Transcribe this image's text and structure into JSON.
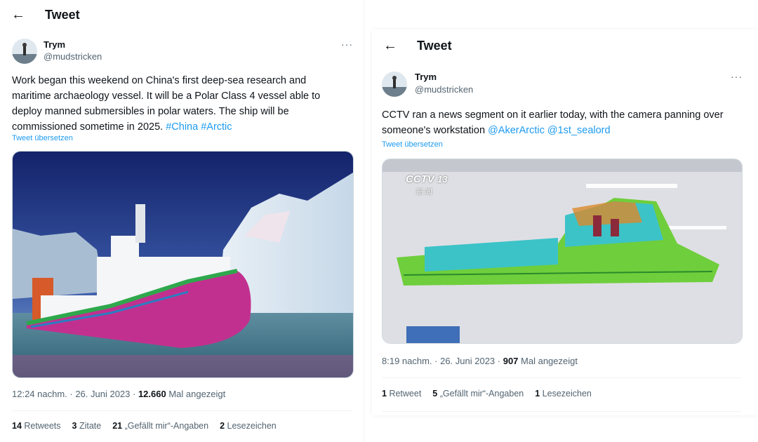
{
  "left": {
    "header_title": "Tweet",
    "user_name": "Trym",
    "user_handle": "@mudstricken",
    "more_glyph": "···",
    "text": "Work began this weekend on China's first deep-sea research and maritime archaeology vessel. It will be a Polar Class 4 vessel able to deploy manned submersibles in polar waters. The ship will be commissioned sometime in 2025. ",
    "tags": [
      "#China",
      "#Arctic"
    ],
    "translate": "Tweet übersetzen",
    "time": "12:24 nachm. · 26. Juni 2023 · ",
    "views_count": "12.660",
    "views_label": " Mal angezeigt",
    "stats": [
      {
        "count": "14",
        "label": "Retweets"
      },
      {
        "count": "3",
        "label": "Zitate"
      },
      {
        "count": "21",
        "label": "„Gefällt mir“-Angaben"
      },
      {
        "count": "2",
        "label": "Lesezeichen"
      }
    ]
  },
  "right": {
    "header_title": "Tweet",
    "user_name": "Trym",
    "user_handle": "@mudstricken",
    "more_glyph": "···",
    "text": "CCTV ran a news segment on it earlier today, with the camera panning over someone's workstation ",
    "mentions": [
      "@AkerArctic",
      "@1st_sealord"
    ],
    "translate": "Tweet übersetzen",
    "watermark_brand": "CCTV",
    "watermark_channel": "13",
    "watermark_sub": "新 闻",
    "time": "8:19 nachm. · 26. Juni 2023 · ",
    "views_count": "907",
    "views_label": " Mal angezeigt",
    "stats": [
      {
        "count": "1",
        "label": "Retweet"
      },
      {
        "count": "5",
        "label": "„Gefällt mir“-Angaben"
      },
      {
        "count": "1",
        "label": "Lesezeichen"
      }
    ]
  },
  "colors": {
    "accent": "#1d9bf0",
    "text": "#0f1419",
    "muted": "#536471",
    "hull_magenta": "#c2308f",
    "model_green": "#6fce3c",
    "model_cyan": "#3cc3c8"
  }
}
